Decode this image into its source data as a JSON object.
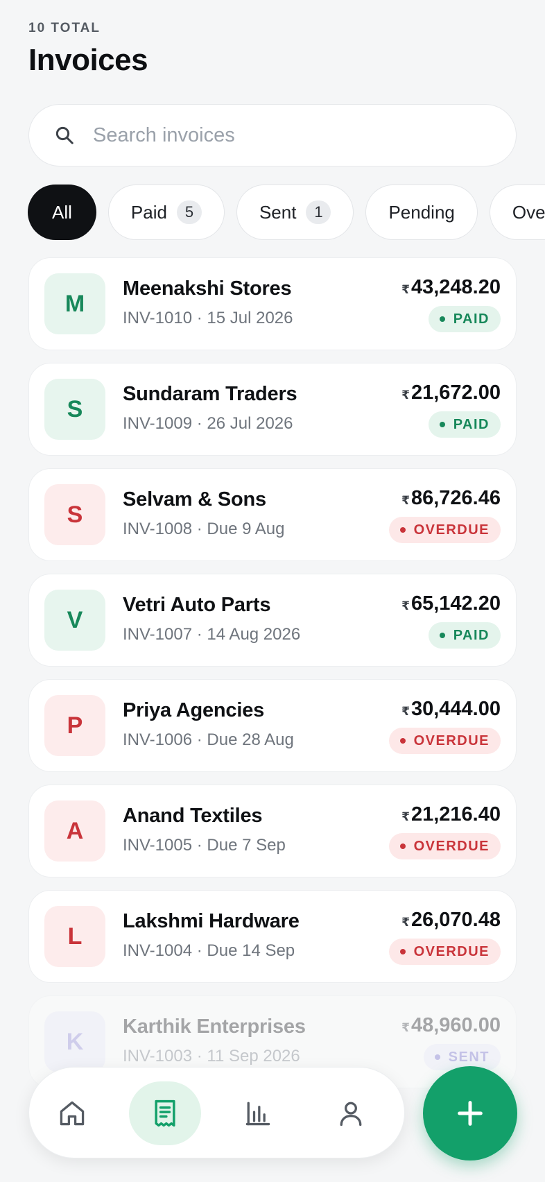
{
  "header": {
    "count_label": "10 TOTAL",
    "title": "Invoices"
  },
  "search": {
    "placeholder": "Search invoices",
    "value": ""
  },
  "filters": [
    {
      "label": "All",
      "count": null,
      "active": true
    },
    {
      "label": "Paid",
      "count": "5",
      "active": false
    },
    {
      "label": "Sent",
      "count": "1",
      "active": false
    },
    {
      "label": "Pending",
      "count": null,
      "active": false
    },
    {
      "label": "Overdue",
      "count": null,
      "active": false
    }
  ],
  "invoices": [
    {
      "initial": "M",
      "client": "Meenakshi Stores",
      "meta": "INV-1010 · 15 Jul 2026",
      "currency": "₹",
      "amount": "43,248.20",
      "status": "PAID"
    },
    {
      "initial": "S",
      "client": "Sundaram Traders",
      "meta": "INV-1009 · 26 Jul 2026",
      "currency": "₹",
      "amount": "21,672.00",
      "status": "PAID"
    },
    {
      "initial": "S",
      "client": "Selvam & Sons",
      "meta": "INV-1008 · Due 9 Aug",
      "currency": "₹",
      "amount": "86,726.46",
      "status": "OVERDUE"
    },
    {
      "initial": "V",
      "client": "Vetri Auto Parts",
      "meta": "INV-1007 · 14 Aug 2026",
      "currency": "₹",
      "amount": "65,142.20",
      "status": "PAID"
    },
    {
      "initial": "P",
      "client": "Priya Agencies",
      "meta": "INV-1006 · Due 28 Aug",
      "currency": "₹",
      "amount": "30,444.00",
      "status": "OVERDUE"
    },
    {
      "initial": "A",
      "client": "Anand Textiles",
      "meta": "INV-1005 · Due 7 Sep",
      "currency": "₹",
      "amount": "21,216.40",
      "status": "OVERDUE"
    },
    {
      "initial": "L",
      "client": "Lakshmi Hardware",
      "meta": "INV-1004 · Due 14 Sep",
      "currency": "₹",
      "amount": "26,070.48",
      "status": "OVERDUE"
    },
    {
      "initial": "K",
      "client": "Karthik Enterprises",
      "meta": "INV-1003 · 11 Sep 2026",
      "currency": "₹",
      "amount": "48,960.00",
      "status": "SENT"
    }
  ],
  "nav": {
    "items": [
      {
        "icon": "home-icon",
        "active": false
      },
      {
        "icon": "receipt-icon",
        "active": true
      },
      {
        "icon": "bar-chart-icon",
        "active": false
      },
      {
        "icon": "user-icon",
        "active": false
      }
    ],
    "fab_icon": "plus-icon"
  },
  "colors": {
    "accent": "#13a06a",
    "paid": "#17885a",
    "overdue": "#c9343a",
    "sent": "#6a63cc",
    "active_chip": "#0f1114"
  }
}
